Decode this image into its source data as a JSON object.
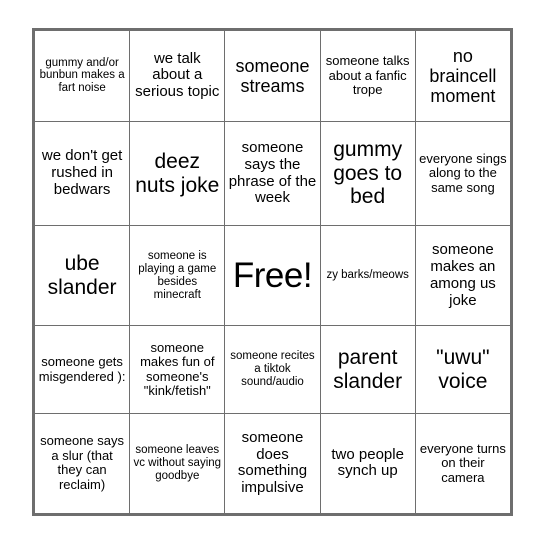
{
  "card": {
    "title": "Bingo Card",
    "rows": 5,
    "columns": 5,
    "border_color": "#6e6e6e",
    "background_color": "#ffffff",
    "text_color": "#000000",
    "free_space": {
      "row": 2,
      "column": 2,
      "label": "Free!"
    },
    "cells": [
      [
        {
          "text": "gummy and/or bunbun makes a fart noise",
          "size": "xs",
          "marked": false
        },
        {
          "text": "we talk about a serious topic",
          "size": "m",
          "marked": false
        },
        {
          "text": "someone streams",
          "size": "l",
          "marked": false
        },
        {
          "text": "someone talks about a fanfic trope",
          "size": "s",
          "marked": false
        },
        {
          "text": "no braincell moment",
          "size": "l",
          "marked": false
        }
      ],
      [
        {
          "text": "we don't get rushed in bedwars",
          "size": "m",
          "marked": false
        },
        {
          "text": "deez nuts joke",
          "size": "xl",
          "marked": false
        },
        {
          "text": "someone says the phrase of the week",
          "size": "m",
          "marked": false
        },
        {
          "text": "gummy goes to bed",
          "size": "xl",
          "marked": false
        },
        {
          "text": "everyone sings along to the same song",
          "size": "s",
          "marked": false
        }
      ],
      [
        {
          "text": "ube slander",
          "size": "xl",
          "marked": false
        },
        {
          "text": "someone is playing a game besides minecraft",
          "size": "xs",
          "marked": false
        },
        {
          "text": "Free!",
          "size": "free",
          "marked": false
        },
        {
          "text": "zy barks/meows",
          "size": "xs",
          "marked": false
        },
        {
          "text": "someone makes an among us joke",
          "size": "m",
          "marked": false
        }
      ],
      [
        {
          "text": "someone gets misgendered ):",
          "size": "s",
          "marked": false
        },
        {
          "text": "someone makes fun of someone's \"kink/fetish\"",
          "size": "s",
          "marked": false
        },
        {
          "text": "someone recites a tiktok sound/audio",
          "size": "xs",
          "marked": false
        },
        {
          "text": "parent slander",
          "size": "xl",
          "marked": false
        },
        {
          "text": "\"uwu\" voice",
          "size": "xl",
          "marked": false
        }
      ],
      [
        {
          "text": "someone says a slur (that they can reclaim)",
          "size": "s",
          "marked": false
        },
        {
          "text": "someone leaves vc without saying goodbye",
          "size": "xs",
          "marked": false
        },
        {
          "text": "someone does something impulsive",
          "size": "m",
          "marked": false
        },
        {
          "text": "two people synch up",
          "size": "m",
          "marked": false
        },
        {
          "text": "everyone turns on their camera",
          "size": "s",
          "marked": false
        }
      ]
    ]
  }
}
